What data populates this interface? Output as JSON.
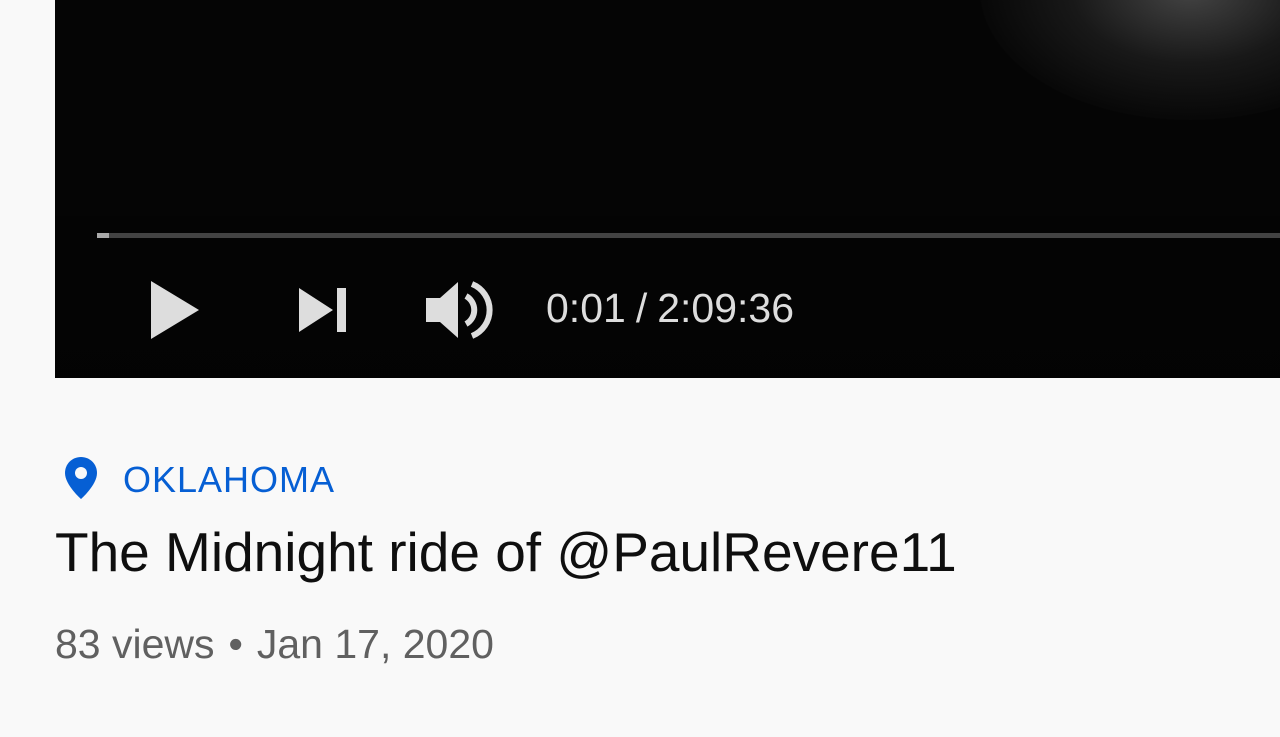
{
  "player": {
    "progress_fraction": 0.0001,
    "current_time": "0:01",
    "separator": "/",
    "duration": "2:09:36",
    "controls": {
      "play_icon": "play-icon",
      "next_icon": "next-icon",
      "volume_icon": "volume-icon"
    }
  },
  "video": {
    "location": "OKLAHOMA",
    "title": "The Midnight ride of @PaulRevere11",
    "views": "83 views",
    "date_separator": "•",
    "date": "Jan 17, 2020"
  },
  "colors": {
    "background": "#f9f9f9",
    "player_bg": "#050505",
    "link_blue": "#065fd4",
    "title_text": "#0f0f0f",
    "meta_text": "#606060",
    "control_white": "#dddddd"
  }
}
